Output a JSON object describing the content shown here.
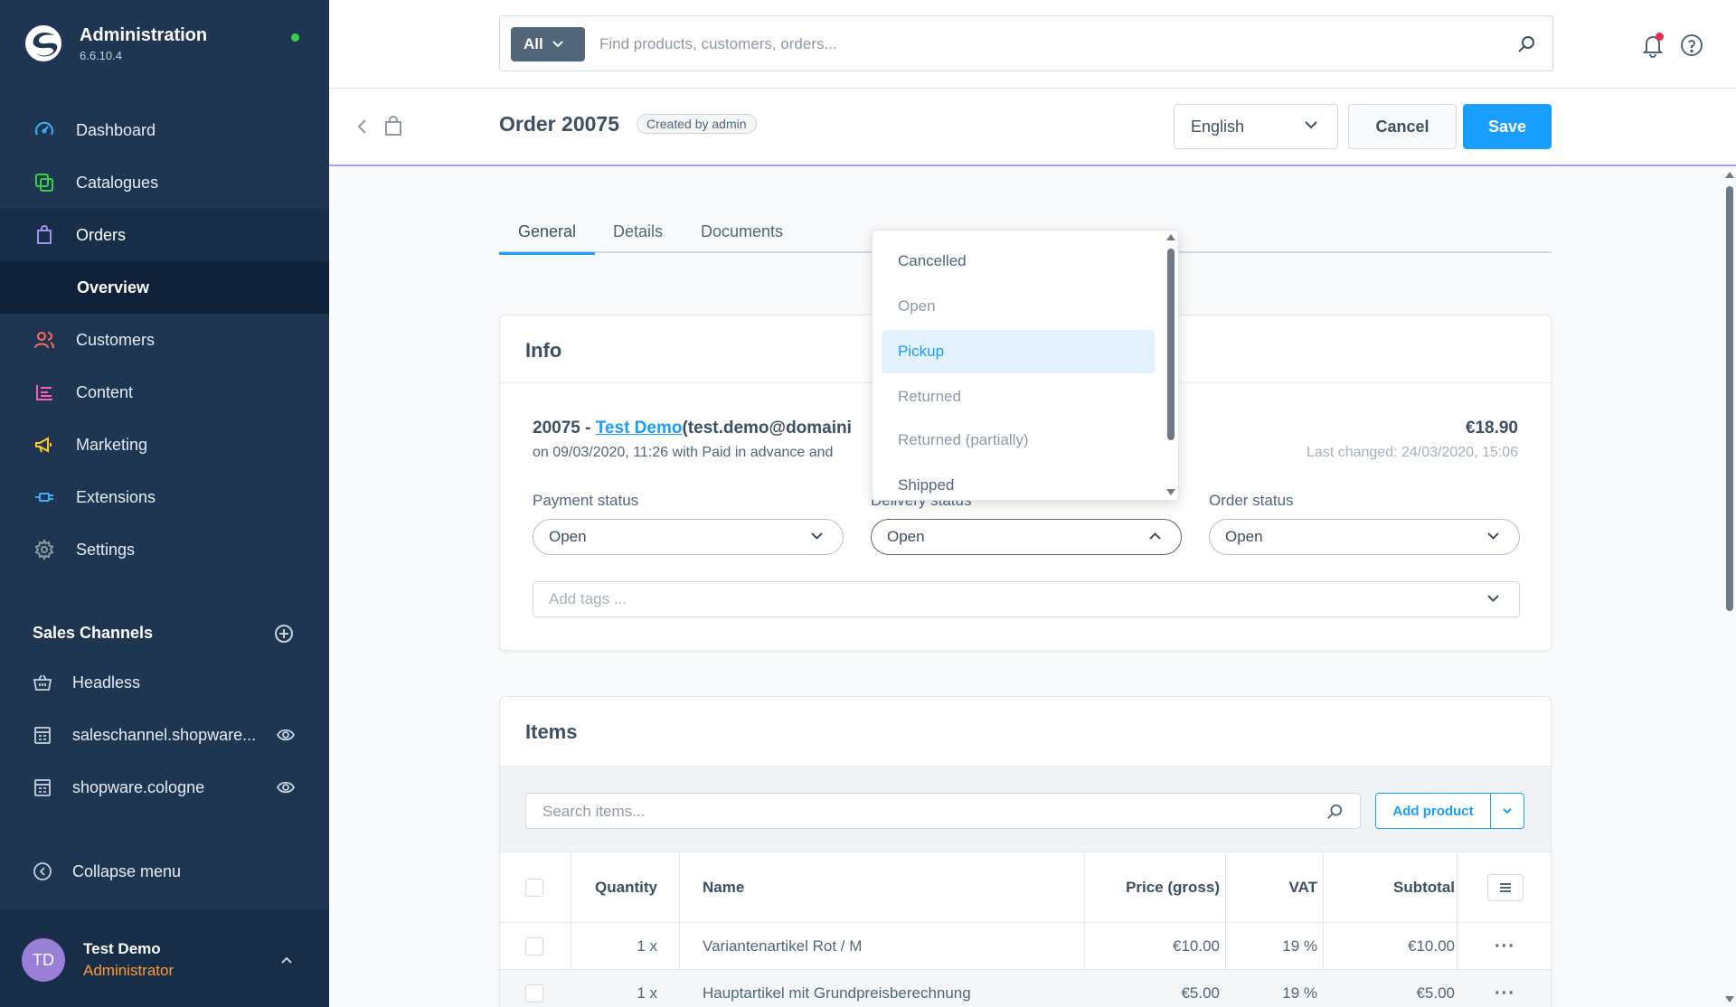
{
  "brand": {
    "title": "Administration",
    "version": "6.6.10.4"
  },
  "nav": {
    "items": [
      {
        "label": "Dashboard",
        "icon": "dashboard-icon"
      },
      {
        "label": "Catalogues",
        "icon": "catalogues-icon"
      },
      {
        "label": "Orders",
        "icon": "orders-icon"
      },
      {
        "label": "Overview"
      },
      {
        "label": "Customers",
        "icon": "customers-icon"
      },
      {
        "label": "Content",
        "icon": "content-icon"
      },
      {
        "label": "Marketing",
        "icon": "marketing-icon"
      },
      {
        "label": "Extensions",
        "icon": "extensions-icon"
      },
      {
        "label": "Settings",
        "icon": "settings-icon"
      }
    ]
  },
  "sales_channels": {
    "title": "Sales Channels",
    "items": [
      {
        "label": "Headless"
      },
      {
        "label": "saleschannel.shopware..."
      },
      {
        "label": "shopware.cologne"
      }
    ]
  },
  "collapse_label": "Collapse menu",
  "user": {
    "initials": "TD",
    "name": "Test Demo",
    "role": "Administrator"
  },
  "search": {
    "scope": "All",
    "placeholder": "Find products, customers, orders..."
  },
  "header": {
    "title": "Order 20075",
    "badge": "Created by admin",
    "language": "English",
    "cancel": "Cancel",
    "save": "Save"
  },
  "tabs": [
    "General",
    "Details",
    "Documents"
  ],
  "info": {
    "title": "Info",
    "order_number": "20075 - ",
    "customer_name": "Test Demo",
    "customer_email": "(test.demo@domaini",
    "order_meta": "on 09/03/2020, 11:26 with Paid in advance and",
    "total": "€18.90",
    "last_changed": "Last changed: 24/03/2020, 15:06",
    "payment_label": "Payment status",
    "payment_value": "Open",
    "delivery_label": "Delivery status",
    "delivery_value": "Open",
    "order_label": "Order status",
    "order_value": "Open",
    "tags_placeholder": "Add tags ..."
  },
  "delivery_options": [
    {
      "label": "Cancelled",
      "state": "normal"
    },
    {
      "label": "Open",
      "state": "muted"
    },
    {
      "label": "Pickup",
      "state": "selected"
    },
    {
      "label": "Returned",
      "state": "muted"
    },
    {
      "label": "Returned (partially)",
      "state": "muted"
    },
    {
      "label": "Shipped",
      "state": "normal"
    }
  ],
  "items": {
    "title": "Items",
    "search_placeholder": "Search items...",
    "add_product": "Add product",
    "columns": [
      "Quantity",
      "Name",
      "Price (gross)",
      "VAT",
      "Subtotal"
    ],
    "rows": [
      {
        "quantity": "1 x",
        "name": "Variantenartikel Rot / M",
        "price": "€10.00",
        "vat": "19 %",
        "subtotal": "€10.00"
      },
      {
        "quantity": "1 x",
        "name": "Hauptartikel mit Grundpreisberechnung",
        "price": "€5.00",
        "vat": "19 %",
        "subtotal": "€5.00"
      }
    ]
  },
  "colors": {
    "sidebar": "#1f3653",
    "accent": "#189eff",
    "role": "#ff9b34",
    "online": "#37d046"
  }
}
